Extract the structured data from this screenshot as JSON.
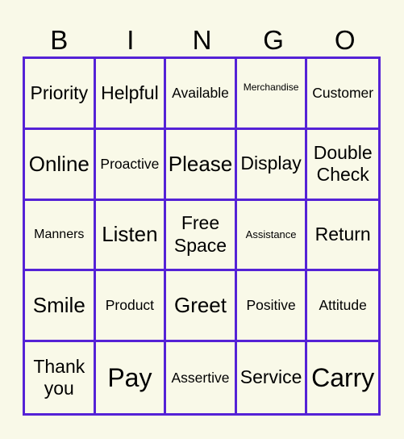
{
  "header": {
    "letters": [
      "B",
      "I",
      "N",
      "G",
      "O"
    ]
  },
  "theme": {
    "background": "#f9f9e8",
    "grid_line_color": "#5522d6",
    "text_color": "#000000"
  },
  "board": {
    "rows": [
      [
        "Priority",
        "Helpful",
        "Available",
        "Merchandise",
        "Customer"
      ],
      [
        "Online",
        "Proactive",
        "Please",
        "Display",
        "Double Check"
      ],
      [
        "Manners",
        "Listen",
        "Free Space",
        "Assistance",
        "Return"
      ],
      [
        "Smile",
        "Product",
        "Greet",
        "Positive",
        "Attitude"
      ],
      [
        "Thank you",
        "Pay",
        "Assertive",
        "Service",
        "Carry"
      ]
    ]
  }
}
